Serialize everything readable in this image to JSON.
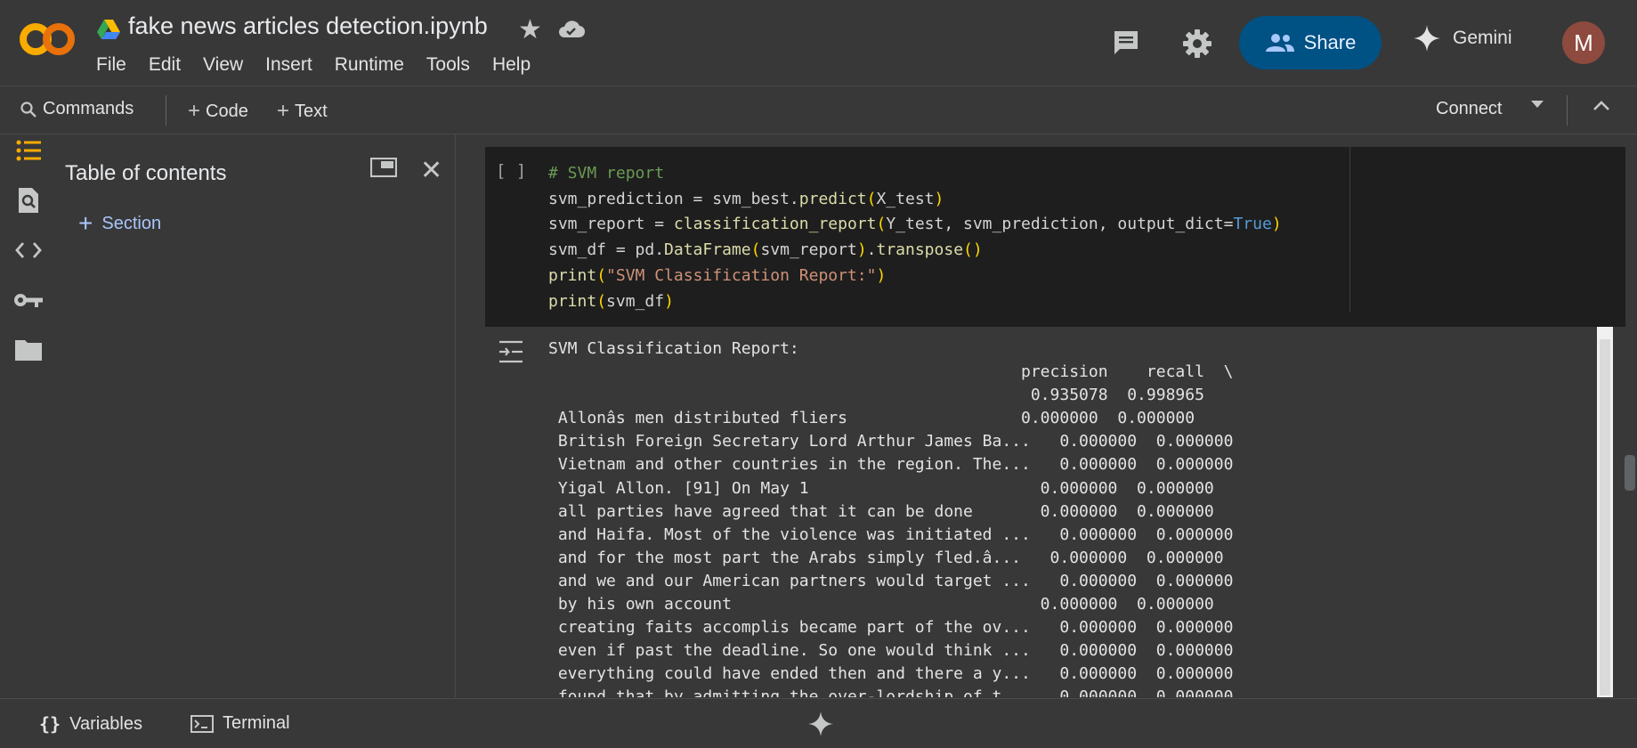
{
  "header": {
    "file_title": "fake news articles detection.ipynb",
    "menu": [
      "File",
      "Edit",
      "View",
      "Insert",
      "Runtime",
      "Tools",
      "Help"
    ],
    "share_label": "Share",
    "gemini_label": "Gemini",
    "avatar_letter": "M"
  },
  "toolbar": {
    "commands_label": "Commands",
    "code_label": "Code",
    "text_label": "Text",
    "connect_label": "Connect"
  },
  "toc": {
    "title": "Table of contents",
    "section_label": "Section"
  },
  "cell": {
    "gutter": "[ ]",
    "code_lines": [
      "# SVM report",
      "svm_prediction = svm_best.predict(X_test)",
      "svm_report = classification_report(Y_test, svm_prediction, output_dict=True)",
      "svm_df = pd.DataFrame(svm_report).transpose()",
      "print(\"SVM Classification Report:\")",
      "print(svm_df)"
    ]
  },
  "output": {
    "lines": [
      "SVM Classification Report:",
      "                                                 precision    recall  \\",
      "                                                  0.935078  0.998965",
      " Allonâs men distributed fliers                  0.000000  0.000000",
      " British Foreign Secretary Lord Arthur James Ba...   0.000000  0.000000",
      " Vietnam and other countries in the region. The...   0.000000  0.000000",
      " Yigal Allon. [91] On May 1                        0.000000  0.000000",
      " all parties have agreed that it can be done       0.000000  0.000000",
      " and Haifa. Most of the violence was initiated ...   0.000000  0.000000",
      " and for the most part the Arabs simply fled.â...   0.000000  0.000000",
      " and we and our American partners would target ...   0.000000  0.000000",
      " by his own account                                0.000000  0.000000",
      " creating faits accomplis became part of the ov...   0.000000  0.000000",
      " even if past the deadline. So one would think ...   0.000000  0.000000",
      " everything could have ended then and there a y...   0.000000  0.000000",
      " found that by admitting the over-lordship of t...   0.000000  0.000000"
    ]
  },
  "bottom": {
    "variables_label": "Variables",
    "terminal_label": "Terminal"
  }
}
